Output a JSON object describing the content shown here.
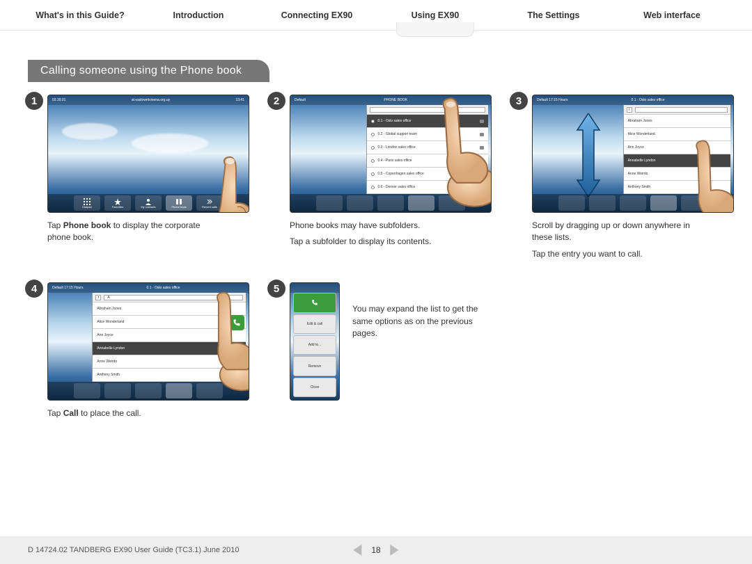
{
  "nav": {
    "items": [
      {
        "label": "What's in this Guide?"
      },
      {
        "label": "Introduction"
      },
      {
        "label": "Connecting EX90"
      },
      {
        "label": "Using EX90",
        "active": true
      },
      {
        "label": "The Settings"
      },
      {
        "label": "Web interface"
      }
    ]
  },
  "section_title": "Calling someone using the Phone book",
  "steps": {
    "s1": {
      "num": "1",
      "caption_pre": "Tap ",
      "caption_bold": "Phone book",
      "caption_post": " to display the corporate phone book.",
      "topbar_left": "03.39.01",
      "topbar_center": "at.easlowntvinena.org.uy",
      "topbar_right": "13:41",
      "bottom_tabs": [
        "Dialpad",
        "Favorites",
        "My contacts",
        "Phone book",
        "Recent calls"
      ]
    },
    "s2": {
      "num": "2",
      "caption_l1": "Phone books may have subfolders.",
      "caption_l2": "Tap a subfolder to display its contents.",
      "topbar_left": "Default",
      "topbar_center": "PHONE BOOK",
      "list": [
        "0.1 - Oslo sales office",
        "0.2 - Global support team",
        "0.3 - London sales office",
        "0.4 - Paris sales office",
        "0.5 - Copenhagen sales office",
        "0.6 - Denver sales office"
      ]
    },
    "s3": {
      "num": "3",
      "caption_l1": "Scroll by dragging up or down anywhere in these lists.",
      "caption_l2": "Tap the entry you want to call.",
      "topbar_left": "Default 17:15 Hours",
      "topbar_center": "0.1 - Oslo sales office",
      "search_letter": "t",
      "list": [
        "Abraham Jones",
        "Alice Wonderland",
        "Ann Joyce",
        "Annabelle Lyndon",
        "Anne Weirdo",
        "Anthony Smith"
      ],
      "selected_index": 3
    },
    "s4": {
      "num": "4",
      "caption_pre": "Tap ",
      "caption_bold": "Call",
      "caption_post": " to place the call.",
      "topbar_left": "Default 17:15 Hours",
      "topbar_center": "0.1 - Oslo sales office",
      "search_letter": "t",
      "search_value": "A",
      "list": [
        "Abraham Jones",
        "Alice Wonderland",
        "Ann Joyce",
        "Annabelle Lyndon",
        "Anne Weirdo",
        "Anthony Smith"
      ],
      "selected_index": 3
    },
    "s5": {
      "num": "5",
      "caption": "You may expand the list to get the same options as on the previous pages.",
      "panel_buttons": [
        "Call",
        "Edit & call",
        "Add to...",
        "Remove",
        "Close"
      ]
    }
  },
  "footer": {
    "doc": "D 14724.02 TANDBERG EX90 User Guide (TC3.1) June 2010",
    "page": "18"
  }
}
